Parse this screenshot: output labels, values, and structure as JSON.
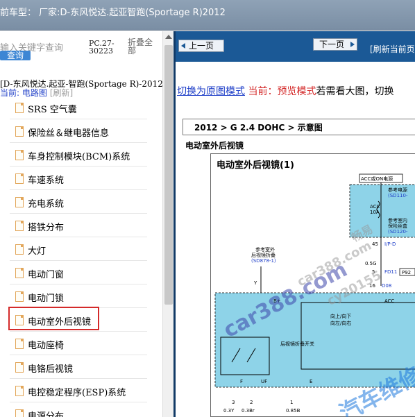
{
  "window": {
    "title": "前车型： 厂家:D-东风悦达.起亚智跑(Sportage R)2012"
  },
  "left_panel": {
    "search_placeholder": "输入关键字查询",
    "query_button": "查询",
    "pc_code": "PC.27-30223",
    "collapse_all": "折叠全部",
    "tree_root": "[D-东风悦达.起亚-智跑(Sportage R)-2012]",
    "current_label": "当前: 电路图",
    "refresh_label": "[刷新]",
    "items": [
      {
        "label": "SRS 空气囊"
      },
      {
        "label": "保险丝＆继电器信息"
      },
      {
        "label": "车身控制模块(BCM)系统"
      },
      {
        "label": "车速系统"
      },
      {
        "label": "充电系统"
      },
      {
        "label": "搭铁分布"
      },
      {
        "label": "大灯"
      },
      {
        "label": "电动门窗"
      },
      {
        "label": "电动门锁"
      },
      {
        "label": "电动室外后视镜"
      },
      {
        "label": "电动座椅"
      },
      {
        "label": "电铬后视镜"
      },
      {
        "label": "电控稳定程序(ESP)系统"
      },
      {
        "label": "电源分布"
      }
    ],
    "selected_item": "电动室外后视镜"
  },
  "right_panel": {
    "prev_button": "上一页",
    "next_button": "下一页",
    "refresh_page": "[刷新当前页",
    "switch_link": "切换为原图模式",
    "current_mode": "当前：预览模式",
    "hint": "若需看大图，切换",
    "breadcrumb": "2012 > G 2.4 DOHC > 示意图",
    "section_title": "电动室外后视镜",
    "diagram_title": "电动室外后视镜(1)",
    "diagram_labels": {
      "acc_on": "ACC或ON电源",
      "ref_power": "参考电源",
      "sd110": "(SD110-",
      "acc_fuse": "ACC",
      "acc_amp": "10A",
      "ref_fuse": "参考室内",
      "fuse_box": "保险丝盒",
      "sd120": "(SD120-",
      "ref_outer": "参考室外",
      "outer_fold": "后视镜折叠",
      "sd878": "(SD878-1)",
      "wire_45": "45",
      "wire_ipd": "I/P-D",
      "wire_05g": "0.5G",
      "wire_5": "5",
      "wire_fd11": "FD11",
      "wire_p92": "P92",
      "wire_16": "16",
      "wire_d08": "D08",
      "y_label": "Y",
      "bplus": "B+",
      "acc2": "ACC",
      "up_down": "向上/向下",
      "left_right": "向左/向右",
      "fold_switch": "后视镜折叠开关",
      "f_label": "F",
      "uf_label": "UF",
      "e_label": "E",
      "pin_3": "3",
      "pin_2": "2",
      "pin_1": "1",
      "w_03y": "0.3Y",
      "w_03br": "0.3Br",
      "w_085b": "0.85B"
    }
  },
  "watermarks": {
    "w1": "car388.com",
    "w2": "car388.com",
    "w3": "cy20155",
    "w4": "汽车维修",
    "w5": "畅易"
  },
  "colors": {
    "title_bar": "#7a8ea4",
    "nav_bar": "#1b5996",
    "selection_outline": "#d42a2a",
    "link_blue": "#1e3ec8",
    "diagram_fill": "#8ed3e8"
  }
}
